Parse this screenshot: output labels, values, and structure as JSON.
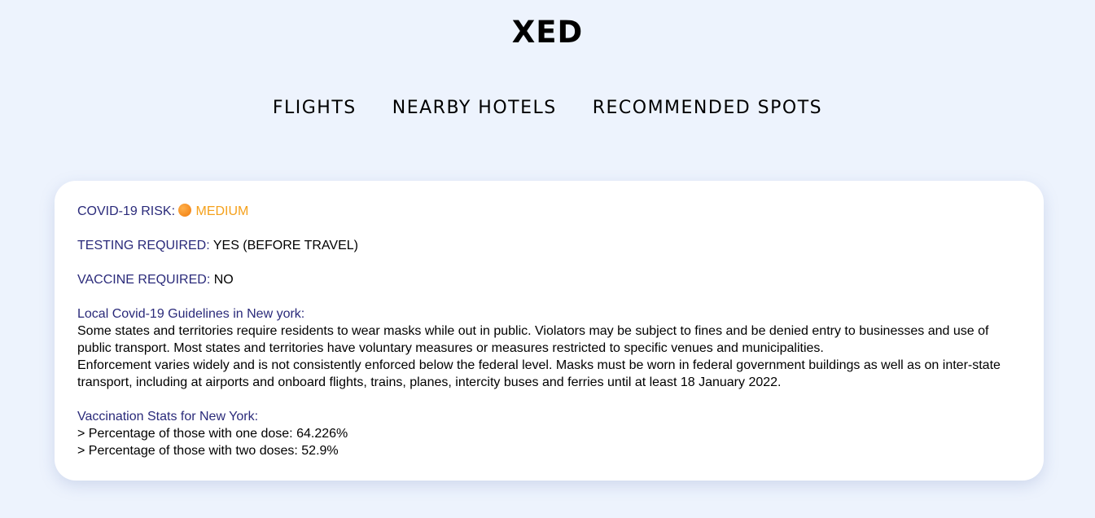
{
  "brand": "XED",
  "nav": {
    "flights": "FLIGHTS",
    "hotels": "NEARBY HOTELS",
    "spots": "RECOMMENDED SPOTS"
  },
  "card": {
    "risk_label": "COVID-19 RISK:",
    "risk_icon": "orange-circle",
    "risk_value": "MEDIUM",
    "testing_label": "TESTING REQUIRED:",
    "testing_value": "YES (BEFORE TRAVEL)",
    "vaccine_label": "VACCINE REQUIRED:",
    "vaccine_value": "NO",
    "guidelines_title": "Local Covid-19 Guidelines in New york:",
    "guidelines_p1": "Some states and territories require residents to wear masks while out in public. Violators may be subject to fines and be denied entry to businesses and use of public transport. Most states and territories have voluntary measures or measures restricted to specific venues and municipalities.",
    "guidelines_p2": "Enforcement varies widely and is not consistently enforced below the federal level. Masks must be worn in federal government buildings as well as on inter-state transport, including at airports and onboard flights, trains, planes, intercity buses and ferries until at least 18 January 2022.",
    "stats_title": "Vaccination Stats for New York:",
    "stat_one_dose": "> Percentage of those with one dose: 64.226%",
    "stat_two_doses": "> Percentage of those with two doses: 52.9%"
  },
  "colors": {
    "background": "#edf3fd",
    "label": "#2a2a7a",
    "risk_medium": "#f5a11c"
  }
}
